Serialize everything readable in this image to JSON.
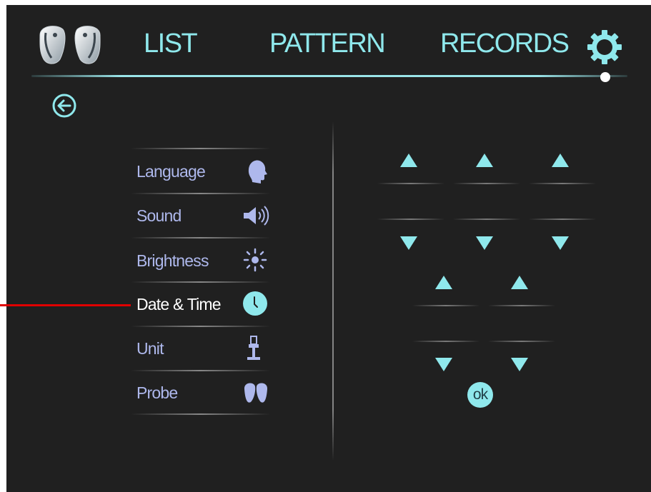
{
  "header": {
    "probe_icon_name": "dual-probe-icon",
    "tabs": [
      {
        "label": "LIST"
      },
      {
        "label": "PATTERN"
      },
      {
        "label": "RECORDS"
      }
    ],
    "settings_icon_name": "gear-icon"
  },
  "back_icon_name": "back-arrow-icon",
  "settings_menu": {
    "items": [
      {
        "label": "Language",
        "icon": "head-icon"
      },
      {
        "label": "Sound",
        "icon": "speaker-icon"
      },
      {
        "label": "Brightness",
        "icon": "sun-icon"
      },
      {
        "label": "Date & Time",
        "icon": "clock-icon",
        "active": true
      },
      {
        "label": "Unit",
        "icon": "cart-icon"
      },
      {
        "label": "Probe",
        "icon": "probe-icon"
      }
    ]
  },
  "date_time_panel": {
    "date_fields": [
      "",
      "",
      ""
    ],
    "time_fields": [
      "",
      ""
    ],
    "ok_label": "ok"
  },
  "colors": {
    "accent": "#8fe8ec",
    "background": "#202020",
    "menu_text": "#aeb8ec",
    "pointer": "#e00000"
  }
}
